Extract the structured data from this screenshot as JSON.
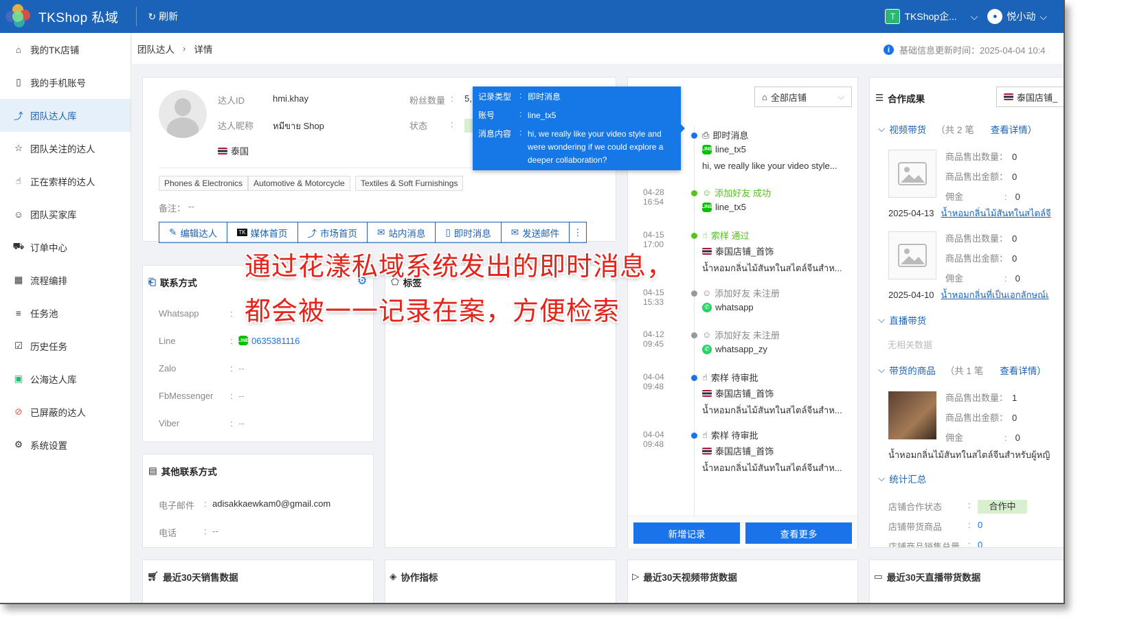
{
  "app": {
    "brand": "TKShop 私域",
    "refresh_label": "刷新",
    "enterprise": "TKShop企...",
    "enterprise_badge": "T",
    "user": "悦小动"
  },
  "sidebar": {
    "items": [
      {
        "label": "我的TK店铺",
        "icon": "store-icon"
      },
      {
        "label": "我的手机账号",
        "icon": "phone-icon"
      },
      {
        "label": "团队达人库",
        "icon": "influencer-icon",
        "active": true
      },
      {
        "label": "团队关注的达人",
        "icon": "star-icon"
      },
      {
        "label": "正在索样的达人",
        "icon": "hand-icon"
      },
      {
        "label": "团队买家库",
        "icon": "buyer-icon"
      },
      {
        "label": "订单中心",
        "icon": "truck-icon"
      },
      {
        "label": "流程编排",
        "icon": "calendar-icon"
      },
      {
        "label": "任务池",
        "icon": "layers-icon"
      },
      {
        "label": "历史任务",
        "icon": "checklist-icon"
      },
      {
        "label": "公海达人库",
        "icon": "public-pool-icon"
      },
      {
        "label": "已屏蔽的达人",
        "icon": "block-icon"
      },
      {
        "label": "系统设置",
        "icon": "gear-icon"
      }
    ]
  },
  "breadcrumb": {
    "parent": "团队达人",
    "current": "详情"
  },
  "update_info": "基础信息更新时间：2025-04-04 10:4",
  "profile": {
    "id_label": "达人ID",
    "id_value": "hmi.khay",
    "nick_label": "达人昵称",
    "nick_value": "หมีขาย Shop",
    "fans_label": "粉丝数量",
    "fans_value": "5,",
    "status_label": "状态",
    "country": "泰国",
    "tags": [
      "Phones & Electronics",
      "Automotive & Motorcycle",
      "Textiles & Soft Furnishings"
    ],
    "remark_label": "备注：",
    "remark_value": "--",
    "actions": [
      "编辑达人",
      "媒体首页",
      "市场首页",
      "站内消息",
      "即时消息",
      "发送邮件"
    ]
  },
  "contact": {
    "title": "联系方式",
    "rows": [
      {
        "label": "Whatsapp",
        "value": ""
      },
      {
        "label": "Line",
        "value": "0635381116"
      },
      {
        "label": "Zalo",
        "value": "--"
      },
      {
        "label": "FbMessenger",
        "value": "--"
      },
      {
        "label": "Viber",
        "value": "--"
      }
    ]
  },
  "tags_card": {
    "title": "标签"
  },
  "other_contact": {
    "title": "其他联系方式",
    "email_label": "电子邮件",
    "email_value": "adisakkaewkam0@gmail.com",
    "phone_label": "电话",
    "phone_value": "--"
  },
  "tooltip": {
    "type_label": "记录类型",
    "type_value": "即时消息",
    "account_label": "账号",
    "account_value": "line_tx5",
    "content_label": "消息内容",
    "content_value": "hi, we really like your video style and were wondering if we could explore a deeper collaboration?"
  },
  "timeline": {
    "store_filter": "全部店铺",
    "items": [
      {
        "time": "",
        "title": "即时消息",
        "line2": "line_tx5",
        "line3": "hi, we really like your video style...",
        "color": "#1a73e8"
      },
      {
        "time": "04-28 16:54",
        "title": "添加好友 成功",
        "line2": "line_tx5",
        "color": "#52c41a"
      },
      {
        "time": "04-15 17:00",
        "title": "索样 通过",
        "line2": "泰国店铺_首饰",
        "line3": "น้ำหอมกลิ่นไม้สันทในสไตล์จีนสำห...",
        "color": "#52c41a"
      },
      {
        "time": "04-15 15:33",
        "title": "添加好友 未注册",
        "line2": "whatsapp",
        "color": "#999999"
      },
      {
        "time": "04-12 09:45",
        "title": "添加好友 未注册",
        "line2": "whatsapp_zy",
        "color": "#999999"
      },
      {
        "time": "04-04 09:48",
        "title": "索样 待审批",
        "line2": "泰国店铺_首饰",
        "line3": "น้ำหอมกลิ่นไม้สันทในสไตล์จีนสำห...",
        "color": "#1a73e8"
      },
      {
        "time": "04-04 09:48",
        "title": "索样 待审批",
        "line2": "泰国店铺_首饰",
        "line3": "น้ำหอมกลิ่นไม้สันทในสไตล์จีนสำห...",
        "color": "#1a73e8"
      }
    ],
    "add_label": "新增记录",
    "more_label": "查看更多"
  },
  "coop": {
    "title": "合作成果",
    "store": "泰国店铺_",
    "video_section": "视频带货",
    "video_count": "（共 2 笔",
    "view_detail": "查看详情）",
    "sold_qty_label": "商品售出数量：",
    "sold_amt_label": "商品售出金额：",
    "commission_label": "佣金",
    "video_items": [
      {
        "qty": "0",
        "amt": "0",
        "comm": "0",
        "date": "2025-04-13",
        "product": "น้ำหอมกลิ่นไม้สันทในสไตล์จี"
      },
      {
        "qty": "0",
        "amt": "0",
        "comm": "0",
        "date": "2025-04-10",
        "product": "น้ำหอมกลิ่นที่เป็นเอกลักษณ์เ"
      }
    ],
    "live_section": "直播带货",
    "no_data": "无相关数据",
    "goods_section": "带货的商品",
    "goods_count": "（共 1 笔",
    "goods_detail": "查看详情）",
    "goods_item": {
      "qty": "1",
      "amt": "0",
      "comm": "0",
      "product": "น้ำหอมกลิ่นไม้สันทในสไตล์จีนสำหรับผู้หญิ"
    },
    "stats_section": "统计汇总",
    "coop_status_label": "店铺合作状态",
    "coop_status_value": "合作中",
    "store_goods_label": "店铺带货商品",
    "store_goods_value": "0",
    "store_sales_label": "店铺商品销售总量",
    "store_sales_value": "0"
  },
  "bottom": [
    "最近30天销售数据",
    "协作指标",
    "最近30天视频带货数据",
    "最近30天直播带货数据"
  ],
  "overlay": {
    "line1": "通过花漾私域系统发出的即时消息，",
    "line2": "都会被一一记录在案，方便检索"
  },
  "colors": {
    "header": "#1a63b8",
    "accent": "#1a73e8",
    "success": "#52c41a",
    "overlay_red": "#e3241b"
  }
}
